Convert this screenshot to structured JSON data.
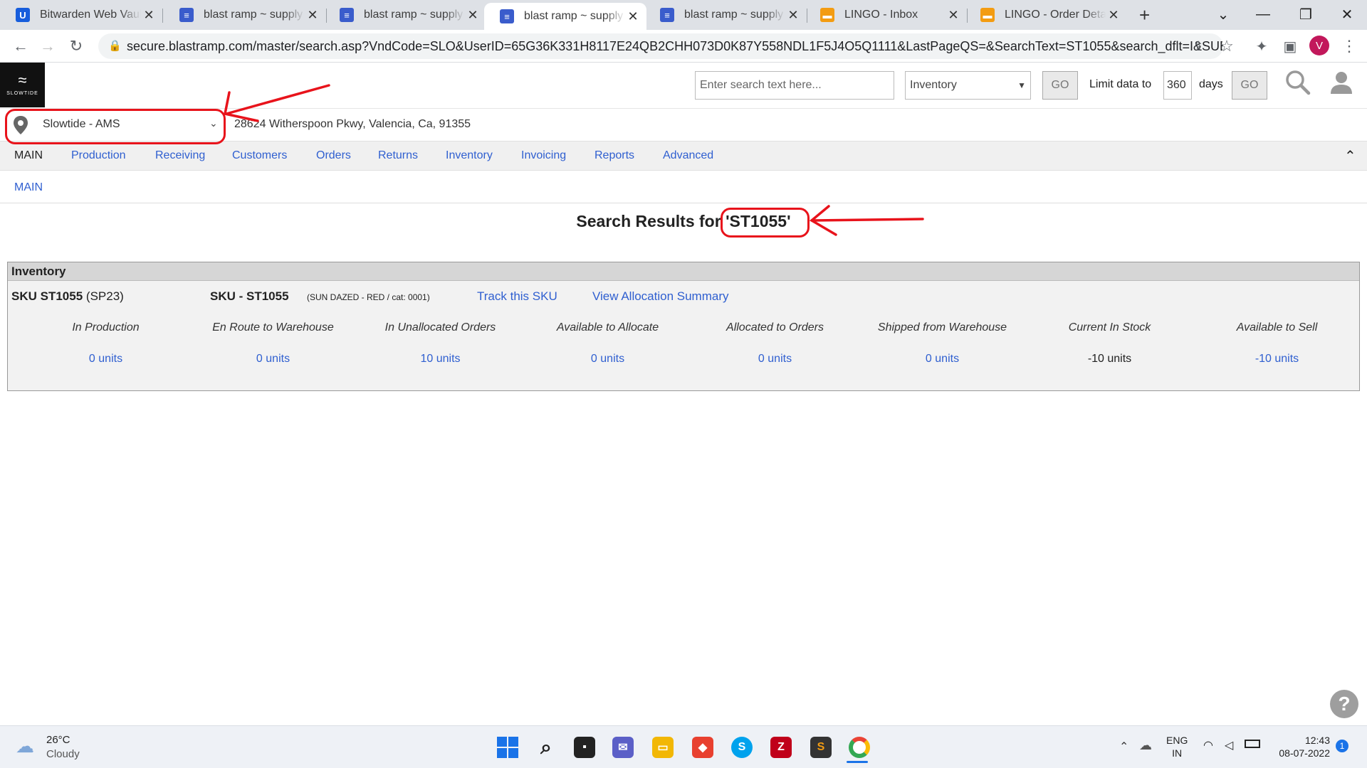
{
  "browser": {
    "tabs": [
      {
        "title": "Bitwarden Web Vault",
        "icon": "bitwarden-icon",
        "color": "#175ddc",
        "glyph": "U"
      },
      {
        "title": "blast ramp ~ supply chain",
        "icon": "document-icon",
        "color": "#3a5ccc",
        "glyph": "≡"
      },
      {
        "title": "blast ramp ~ supply chain",
        "icon": "document-icon",
        "color": "#3a5ccc",
        "glyph": "≡"
      },
      {
        "title": "blast ramp ~ supply chain",
        "icon": "document-icon",
        "color": "#3a5ccc",
        "glyph": "≡"
      },
      {
        "title": "blast ramp ~ supply chain",
        "icon": "document-icon",
        "color": "#3a5ccc",
        "glyph": "≡"
      },
      {
        "title": "LINGO - Inbox",
        "icon": "lingo-icon",
        "color": "#f39c12",
        "glyph": "▬"
      },
      {
        "title": "LINGO - Order Detail",
        "icon": "lingo-icon",
        "color": "#f39c12",
        "glyph": "▬"
      }
    ],
    "active_tab": 3,
    "new_tab": "+",
    "url": "secure.blastramp.com/master/search.asp?VndCode=SLO&UserID=65G36K331H8117E24QB2CHH073D0K87Y558NDL1F5J4O5Q1111&LastPageQS=&SearchText=ST1055&search_dflt=I&SUBs...",
    "profile_initial": "V"
  },
  "header": {
    "logo_text": "SLOWTIDE",
    "search_placeholder": "Enter search text here...",
    "search_type": "Inventory",
    "go_label": "GO",
    "limit_label": "Limit data to",
    "limit_days_value": "360",
    "days_label": "days",
    "go2_label": "GO"
  },
  "location": {
    "selected": "Slowtide - AMS",
    "address": "28624 Witherspoon Pkwy, Valencia, Ca, 91355"
  },
  "menu": {
    "items": [
      "MAIN",
      "Production",
      "Receiving",
      "Customers",
      "Orders",
      "Returns",
      "Inventory",
      "Invoicing",
      "Reports",
      "Advanced"
    ],
    "breadcrumb": "MAIN"
  },
  "results": {
    "title_prefix": "Search Results for ",
    "query": "'ST1055'",
    "section": "Inventory",
    "sku_label": "SKU ST1055",
    "sku_season": "(SP23)",
    "sku_name": "SKU - ST1055",
    "sku_desc": "(SUN DAZED - RED / cat: 0001)",
    "track_link": "Track this SKU",
    "allocation_link": "View Allocation Summary",
    "stats": [
      {
        "label": "In Production",
        "value": "0 units",
        "link": true
      },
      {
        "label": "En Route to Warehouse",
        "value": "0 units",
        "link": true
      },
      {
        "label": "In Unallocated Orders",
        "value": "10 units",
        "link": true
      },
      {
        "label": "Available to Allocate",
        "value": "0 units",
        "link": true
      },
      {
        "label": "Allocated to Orders",
        "value": "0 units",
        "link": true
      },
      {
        "label": "Shipped from Warehouse",
        "value": "0 units",
        "link": true
      },
      {
        "label": "Current In Stock",
        "value": "-10 units",
        "link": false
      },
      {
        "label": "Available to Sell",
        "value": "-10 units",
        "link": true
      }
    ]
  },
  "taskbar": {
    "weather_temp": "26°C",
    "weather_desc": "Cloudy",
    "lang_top": "ENG",
    "lang_bottom": "IN",
    "time": "12:43",
    "date": "08-07-2022",
    "notification_count": "1"
  },
  "colors": {
    "link": "#2f5fd0",
    "annotation_red": "#e8131b"
  }
}
